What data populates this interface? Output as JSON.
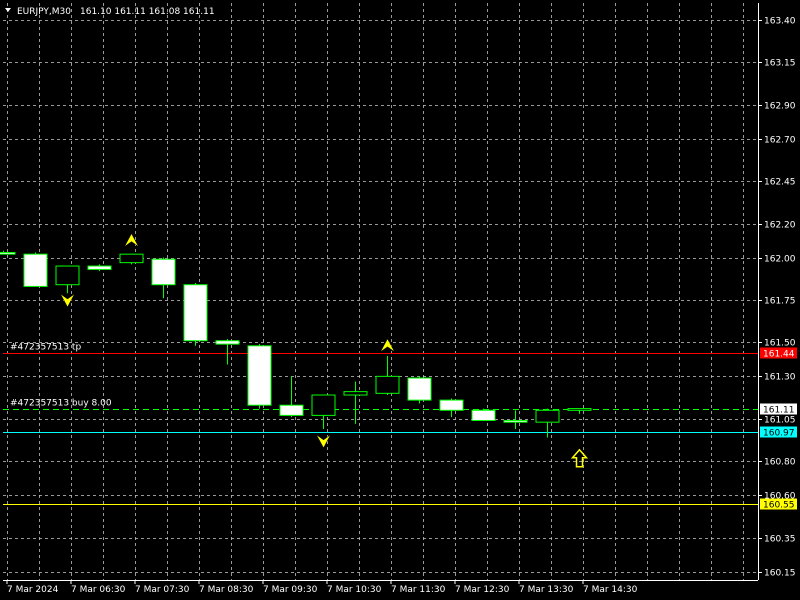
{
  "header": {
    "menu_icon": "triangle-down-icon",
    "symbol": "EURJPY,M30",
    "ohlc": "161.10 161.11 161.08 161.11"
  },
  "colors": {
    "background": "#000000",
    "grid": "#c0c0c0",
    "bull_body": "#000000",
    "bear_body": "#ffffff",
    "candle_outline": "#00ff00",
    "tp_line": "#ff0000",
    "entry_line": "#00ff00",
    "bid_line": "#00ffff",
    "yellow_line": "#ffff00",
    "arrow": "#ffff00"
  },
  "orders": {
    "tp_label": "#472357513 tp",
    "entry_label": "#472357513 buy 8.00"
  },
  "price_tags": [
    {
      "name": "tp-price-tag",
      "label": "161.44",
      "value": 161.44,
      "bg": "#ff0000",
      "fg": "#ffffff"
    },
    {
      "name": "entry-price-tag",
      "label": "161.11",
      "value": 161.11,
      "bg": "#ffffff",
      "fg": "#000000"
    },
    {
      "name": "bid-price-tag",
      "label": "160.97",
      "value": 160.97,
      "bg": "#00ffff",
      "fg": "#000000"
    },
    {
      "name": "yellow-price-tag",
      "label": "160.55",
      "value": 160.55,
      "bg": "#ffff00",
      "fg": "#000000"
    }
  ],
  "chart_data": {
    "type": "candlestick",
    "ylim": [
      160.1,
      163.5
    ],
    "y_ticks": [
      "163.40",
      "163.15",
      "162.90",
      "162.70",
      "162.45",
      "162.20",
      "162.00",
      "161.75",
      "161.50",
      "161.30",
      "161.05",
      "160.80",
      "160.60",
      "160.35",
      "160.15"
    ],
    "x_ticks": [
      "7 Mar 2024",
      "7 Mar 06:30",
      "7 Mar 07:30",
      "7 Mar 08:30",
      "7 Mar 09:30",
      "7 Mar 10:30",
      "7 Mar 11:30",
      "7 Mar 12:30",
      "7 Mar 13:30",
      "7 Mar 14:30"
    ],
    "candles": [
      {
        "o": 162.03,
        "h": 162.04,
        "l": 162.02,
        "c": 162.02
      },
      {
        "o": 162.02,
        "h": 162.03,
        "l": 161.83,
        "c": 161.83
      },
      {
        "o": 161.84,
        "h": 161.95,
        "l": 161.79,
        "c": 161.95
      },
      {
        "o": 161.95,
        "h": 161.96,
        "l": 161.92,
        "c": 161.93
      },
      {
        "o": 161.97,
        "h": 162.02,
        "l": 161.96,
        "c": 162.02
      },
      {
        "o": 161.99,
        "h": 162.0,
        "l": 161.76,
        "c": 161.84
      },
      {
        "o": 161.84,
        "h": 161.85,
        "l": 161.48,
        "c": 161.51
      },
      {
        "o": 161.51,
        "h": 161.52,
        "l": 161.37,
        "c": 161.49
      },
      {
        "o": 161.48,
        "h": 161.49,
        "l": 161.11,
        "c": 161.13
      },
      {
        "o": 161.13,
        "h": 161.3,
        "l": 161.06,
        "c": 161.07
      },
      {
        "o": 161.07,
        "h": 161.19,
        "l": 160.99,
        "c": 161.19
      },
      {
        "o": 161.19,
        "h": 161.27,
        "l": 161.02,
        "c": 161.21
      },
      {
        "o": 161.2,
        "h": 161.42,
        "l": 161.19,
        "c": 161.3
      },
      {
        "o": 161.29,
        "h": 161.3,
        "l": 161.14,
        "c": 161.16
      },
      {
        "o": 161.16,
        "h": 161.17,
        "l": 161.06,
        "c": 161.1
      },
      {
        "o": 161.1,
        "h": 161.11,
        "l": 161.04,
        "c": 161.04
      },
      {
        "o": 161.04,
        "h": 161.1,
        "l": 160.99,
        "c": 161.03
      },
      {
        "o": 161.03,
        "h": 161.11,
        "l": 160.94,
        "c": 161.1
      },
      {
        "o": 161.1,
        "h": 161.11,
        "l": 161.08,
        "c": 161.11
      }
    ],
    "arrows": [
      {
        "candle": 4,
        "dir": "up",
        "price": 162.1
      },
      {
        "candle": 2,
        "dir": "down",
        "price": 161.75
      },
      {
        "candle": 12,
        "dir": "up",
        "price": 161.48
      },
      {
        "candle": 10,
        "dir": "down",
        "price": 160.92
      },
      {
        "candle": 18,
        "dir": "buy-arrow",
        "price": 160.82
      }
    ],
    "levels": [
      {
        "name": "tp-line",
        "price": 161.44,
        "color": "#ff0000",
        "style": "solid"
      },
      {
        "name": "entry-line",
        "price": 161.11,
        "color": "#00ff00",
        "style": "dashed"
      },
      {
        "name": "bid-line",
        "price": 160.97,
        "color": "#00ffff",
        "style": "solid"
      },
      {
        "name": "yellow-line",
        "price": 160.55,
        "color": "#ffff00",
        "style": "solid"
      }
    ]
  }
}
